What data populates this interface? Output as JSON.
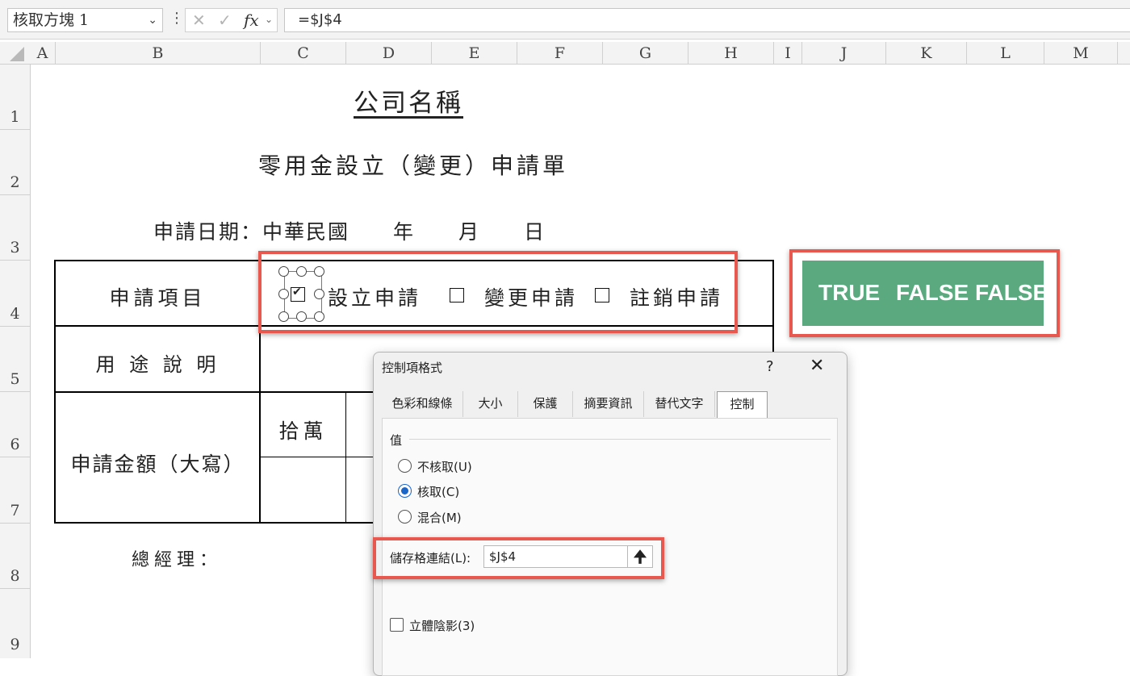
{
  "formula_bar": {
    "name_box": "核取方塊 1",
    "cancel_symbol": "✕",
    "enter_symbol": "✓",
    "fx_label": "fx",
    "formula": "=$J$4"
  },
  "columns": [
    "A",
    "B",
    "C",
    "D",
    "E",
    "F",
    "G",
    "H",
    "I",
    "J",
    "K",
    "L",
    "M"
  ],
  "rows": [
    "1",
    "2",
    "3",
    "4",
    "5",
    "6",
    "7",
    "8",
    "9"
  ],
  "sheet": {
    "company": "公司名稱",
    "form_title": "零用金設立（變更）申請單",
    "date_line": "申請日期：中華民國　　年　　月　　日",
    "row_apply_item": "申請項目",
    "row_purpose": "用 途 說 明",
    "row_amount": "申請金額（大寫）",
    "amount_unit": "拾萬",
    "manager": "總經理：",
    "options": [
      {
        "label": "設立申請",
        "checked": true
      },
      {
        "label": "變更申請",
        "checked": false
      },
      {
        "label": "註銷申請",
        "checked": false
      }
    ],
    "check_mark": "✔",
    "linked_values": [
      "TRUE",
      "FALSE",
      "FALSE"
    ]
  },
  "dialog": {
    "title": "控制項格式",
    "help": "?",
    "close": "✕",
    "tabs": [
      "色彩和線條",
      "大小",
      "保護",
      "摘要資訊",
      "替代文字",
      "控制"
    ],
    "active_tab": "控制",
    "value_group": "值",
    "radios": [
      {
        "label": "不核取(U)",
        "selected": false
      },
      {
        "label": "核取(C)",
        "selected": true
      },
      {
        "label": "混合(M)",
        "selected": false
      }
    ],
    "cell_link_label": "儲存格連結(L):",
    "cell_link_value": "$J$4",
    "cell_link_button": "🠉",
    "shadow_label": "立體陰影(3)",
    "shadow_checked": false
  },
  "colors": {
    "highlight": "#e8584f",
    "result_fill": "#5aa97f",
    "radio_accent": "#1a65c8"
  }
}
